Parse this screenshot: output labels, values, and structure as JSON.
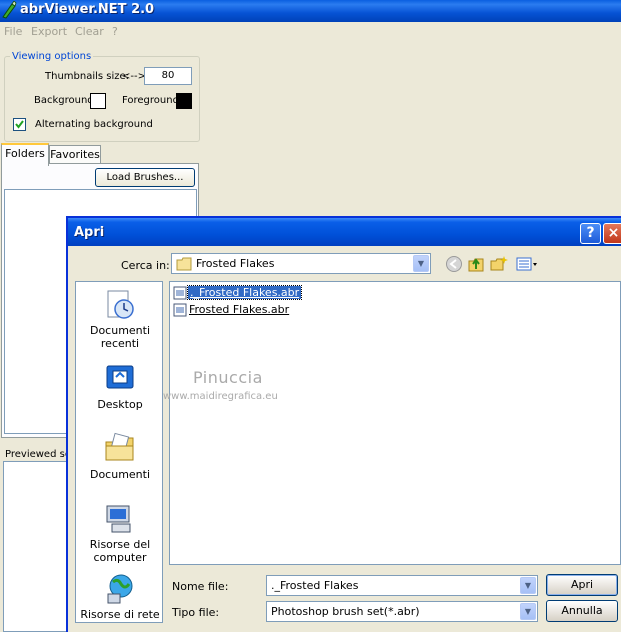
{
  "app": {
    "title": "abrViewer.NET 2.0"
  },
  "menu": [
    "File",
    "Export",
    "Clear",
    "?"
  ],
  "viewing_options": {
    "legend": "Viewing options",
    "thumbnails_label": "Thumbnails size:",
    "thumbnails_arrows": "<-->",
    "thumbnails_value": "80",
    "background_label": "Background:",
    "background_color": "#ffffff",
    "foreground_label": "Foreground:",
    "foreground_color": "#000000",
    "alternating_label": "Alternating background",
    "alternating_checked": true
  },
  "tabs": {
    "folders": "Folders",
    "favorites": "Favorites",
    "active": "folders"
  },
  "load_brushes_label": "Load Brushes...",
  "previewed_label": "Previewed set:",
  "dialog": {
    "title": "Apri",
    "help_icon": "?",
    "close_icon": "×",
    "lookin_label": "Cerca in:",
    "lookin_value": "Frosted Flakes",
    "places": [
      {
        "label": "Documenti recenti",
        "icon": "recent-documents-icon"
      },
      {
        "label": "Desktop",
        "icon": "desktop-icon"
      },
      {
        "label": "Documenti",
        "icon": "documents-folder-icon"
      },
      {
        "label": "Risorse del computer",
        "icon": "my-computer-icon"
      },
      {
        "label": "Risorse di rete",
        "icon": "network-icon"
      }
    ],
    "files": [
      {
        "name": "._Frosted Flakes.abr",
        "selected": true
      },
      {
        "name": "Frosted Flakes.abr",
        "selected": false
      }
    ],
    "filename_label": "Nome file:",
    "filename_value": "._Frosted Flakes",
    "filetype_label": "Tipo file:",
    "filetype_value": "Photoshop brush set(*.abr)",
    "open_label": "Apri",
    "cancel_label": "Annulla"
  },
  "watermark": {
    "name": "Pinuccia",
    "url": "www.maidiregrafica.eu"
  },
  "colors": {
    "titlebar": "#0050d8",
    "selection": "#316ac5",
    "legend": "#0046d5"
  }
}
